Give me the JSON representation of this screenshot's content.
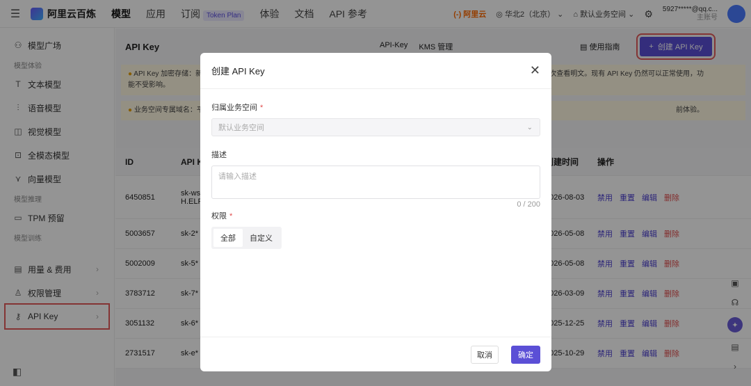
{
  "topbar": {
    "brand": "阿里云百炼",
    "nav": [
      "模型",
      "应用",
      "订阅",
      "体验",
      "文档",
      "API 参考"
    ],
    "token_badge": "Token Plan",
    "aliyun": "(-) 阿里云",
    "region": "华北2（北京）",
    "workspace": "默认业务空间",
    "account": "5927*****@qq.c...",
    "account_sub": "主账号"
  },
  "sidebar": {
    "items": [
      {
        "label": "模型广场",
        "icon": "model-square-icon"
      },
      {
        "group": "模型体验"
      },
      {
        "label": "文本模型",
        "icon": "text-icon"
      },
      {
        "label": "语音模型",
        "icon": "voice-icon"
      },
      {
        "label": "视觉模型",
        "icon": "camera-icon"
      },
      {
        "label": "全模态模型",
        "icon": "multimodal-icon"
      },
      {
        "label": "向量模型",
        "icon": "vector-icon"
      },
      {
        "group": "模型推理"
      },
      {
        "label": "TPM 预留",
        "icon": "tpm-icon"
      },
      {
        "group": "模型训练"
      },
      {
        "label": "用量 & 费用",
        "icon": "usage-icon"
      },
      {
        "label": "权限管理",
        "icon": "permission-icon"
      },
      {
        "label": "API Key",
        "icon": "key-icon"
      }
    ]
  },
  "main": {
    "title": "API Key",
    "tabs": [
      "API-Key",
      "KMS 管理"
    ],
    "guide": "使用指南",
    "create_button": "创建 API Key",
    "notice1_start": "API Key 加密存储：新",
    "notice1_end": "次查看明文。现有 API Key 仍然可以正常使用，功",
    "notice1_line2": "能不受影响。",
    "notice2_start": "业务空间专属域名：平",
    "notice2_end": "前体验。",
    "columns": [
      "ID",
      "API K",
      "创建时间",
      "操作"
    ],
    "rows": [
      {
        "id": "6450851",
        "key": "sk-ws",
        "key2": "H.ELF",
        "date": "2026-08-03"
      },
      {
        "id": "5003657",
        "key": "sk-2*",
        "date": "2026-05-08"
      },
      {
        "id": "5002009",
        "key": "sk-5*",
        "date": "2026-05-08"
      },
      {
        "id": "3783712",
        "key": "sk-7*",
        "date": "2026-03-09"
      },
      {
        "id": "3051132",
        "key": "sk-6*",
        "date": "2025-12-25"
      },
      {
        "id": "2731517",
        "key": "sk-e*",
        "date": "2025-10-29"
      }
    ],
    "ops": [
      "禁用",
      "重置",
      "编辑",
      "删除"
    ]
  },
  "modal": {
    "title": "创建 API Key",
    "workspace_label": "归属业务空间",
    "workspace_value": "默认业务空间",
    "desc_label": "描述",
    "desc_placeholder": "请输入描述",
    "desc_count": "0 / 200",
    "perm_label": "权限",
    "perm_options": [
      "全部",
      "自定义"
    ],
    "cancel": "取消",
    "ok": "确定"
  }
}
